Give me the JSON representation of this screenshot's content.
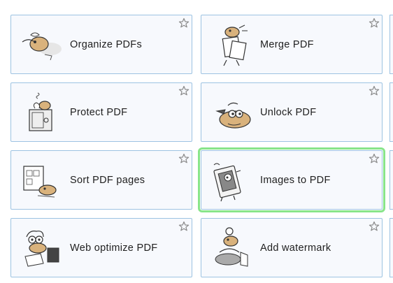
{
  "tools": [
    {
      "label": "Organize PDFs",
      "icon": "organize-pdfs-illustration"
    },
    {
      "label": "Merge PDF",
      "icon": "merge-pdf-illustration"
    },
    {
      "label": "Protect PDF",
      "icon": "protect-pdf-illustration"
    },
    {
      "label": "Unlock PDF",
      "icon": "unlock-pdf-illustration"
    },
    {
      "label": "Sort PDF pages",
      "icon": "sort-pdf-pages-illustration"
    },
    {
      "label": "Images to PDF",
      "icon": "images-to-pdf-illustration"
    },
    {
      "label": "Web optimize PDF",
      "icon": "web-optimize-pdf-illustration"
    },
    {
      "label": "Add watermark",
      "icon": "add-watermark-illustration"
    }
  ],
  "favorite_icon": "star-outline-icon",
  "colors": {
    "card_border": "#9dc3e2",
    "card_background": "#f7f9fd",
    "highlight": "#88e58a",
    "label_text": "#1f1f1f",
    "illustration_accent": "#d9b27c"
  }
}
